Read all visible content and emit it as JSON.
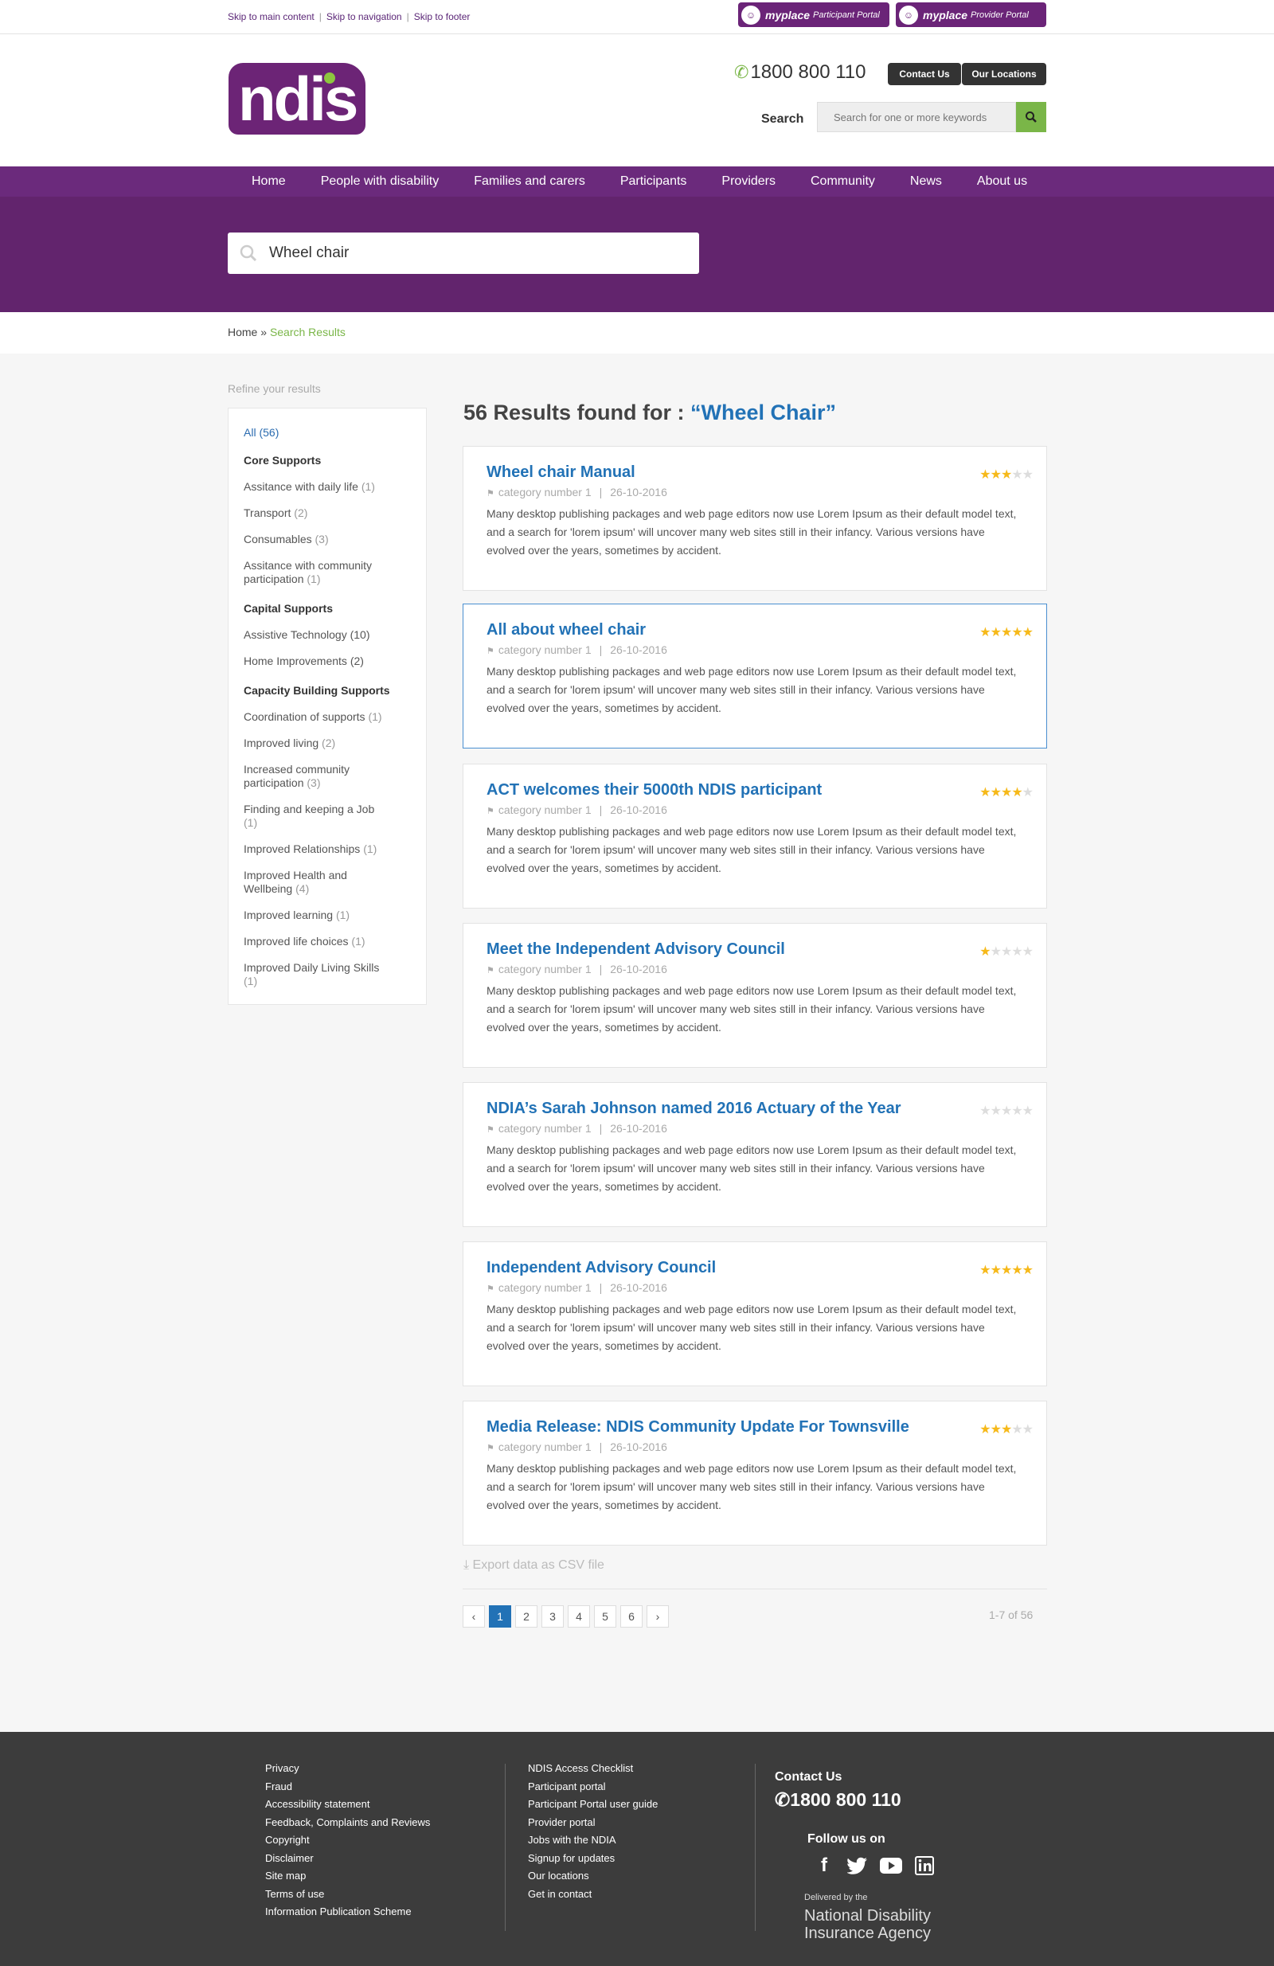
{
  "skip_links": [
    "Skip to main content",
    "Skip to navigation",
    "Skip to footer"
  ],
  "portals": [
    {
      "brand": "myplace",
      "label": "Participant Portal"
    },
    {
      "brand": "myplace",
      "label": "Provider Portal"
    }
  ],
  "header": {
    "logo_text": "ndis",
    "phone": "1800 800 110",
    "contact_button": "Contact Us",
    "locations_button": "Our Locations",
    "search_label": "Search",
    "search_placeholder": "Search for one or more keywords"
  },
  "nav": [
    "Home",
    "People with disability",
    "Families and carers",
    "Participants",
    "Providers",
    "Community",
    "News",
    "About us"
  ],
  "hero_search": {
    "value": "Wheel chair"
  },
  "breadcrumb": {
    "home": "Home",
    "separator": "»",
    "current": "Search Results"
  },
  "sidebar": {
    "title": "Refine your results",
    "all": {
      "label": "All",
      "count": "(56)"
    },
    "groups": [
      {
        "heading": "Core Supports",
        "items": [
          {
            "label": "Assitance with daily life",
            "count": "(1)"
          },
          {
            "label": "Transport",
            "count": "(2)"
          },
          {
            "label": "Consumables",
            "count": "(3)"
          },
          {
            "label": "Assitance with community participation",
            "count": "(1)"
          }
        ]
      },
      {
        "heading": "Capital Supports",
        "items": [
          {
            "label": "Assistive Technology",
            "count": "(10)"
          },
          {
            "label": "Home Improvements",
            "count": "(2)"
          }
        ]
      },
      {
        "heading": "Capacity Building Supports",
        "items": [
          {
            "label": "Coordination of supports",
            "count": "(1)"
          },
          {
            "label": "Improved living",
            "count": "(2)"
          },
          {
            "label": "Increased community participation",
            "count": "(3)"
          },
          {
            "label": "Finding and keeping a Job",
            "count": "(1)"
          },
          {
            "label": "Improved Relationships",
            "count": "(1)"
          },
          {
            "label": "Improved Health and Wellbeing",
            "count": "(4)"
          },
          {
            "label": "Improved learning",
            "count": "(1)"
          },
          {
            "label": "Improved life choices",
            "count": "(1)"
          },
          {
            "label": "Improved Daily Living Skills",
            "count": "(1)"
          }
        ]
      }
    ]
  },
  "results": {
    "heading_prefix": "56 Results found for :",
    "query": "“Wheel Chair”",
    "items": [
      {
        "title": "Wheel chair Manual",
        "category": "category number 1",
        "date": "26-10-2016",
        "rating": 3,
        "text": "Many desktop publishing packages and web page editors now use Lorem Ipsum as their default model text, and a search for 'lorem ipsum' will uncover many web sites still in their infancy. Various versions have evolved over the years, sometimes by accident."
      },
      {
        "title": "All about wheel chair",
        "category": "category number 1",
        "date": "26-10-2016",
        "rating": 5,
        "text": "Many desktop publishing packages and web page editors now use Lorem Ipsum as their default model text, and a search for 'lorem ipsum' will uncover many web sites still in their infancy. Various versions have evolved over the years, sometimes by accident."
      },
      {
        "title": "ACT welcomes their 5000th NDIS participant",
        "category": "category number 1",
        "date": "26-10-2016",
        "rating": 4,
        "text": "Many desktop publishing packages and web page editors now use Lorem Ipsum as their default model text, and a search for 'lorem ipsum' will uncover many web sites still in their infancy. Various versions have evolved over the years, sometimes by accident."
      },
      {
        "title": "Meet the Independent Advisory Council",
        "category": "category number 1",
        "date": "26-10-2016",
        "rating": 1,
        "text": "Many desktop publishing packages and web page editors now use Lorem Ipsum as their default model text, and a search for 'lorem ipsum' will uncover many web sites still in their infancy. Various versions have evolved over the years, sometimes by accident."
      },
      {
        "title": "NDIA’s Sarah Johnson named 2016 Actuary of the Year",
        "category": "category number 1",
        "date": "26-10-2016",
        "rating": 0,
        "text": "Many desktop publishing packages and web page editors now use Lorem Ipsum as their default model text, and a search for 'lorem ipsum' will uncover many web sites still in their infancy. Various versions have evolved over the years, sometimes by accident."
      },
      {
        "title": "Independent Advisory Council",
        "category": "category number 1",
        "date": "26-10-2016",
        "rating": 5,
        "text": "Many desktop publishing packages and web page editors now use Lorem Ipsum as their default model text, and a search for 'lorem ipsum' will uncover many web sites still in their infancy. Various versions have evolved over the years, sometimes by accident."
      },
      {
        "title": "Media Release: NDIS Community Update For Townsville",
        "category": "category number 1",
        "date": "26-10-2016",
        "rating": 3,
        "text": "Many desktop publishing packages and web page editors now use Lorem Ipsum as their default model text, and a search for 'lorem ipsum' will uncover many web sites still in their infancy. Various versions have evolved over the years, sometimes by accident."
      }
    ],
    "export_label": "Export data as CSV file",
    "pages": [
      "1",
      "2",
      "3",
      "4",
      "5",
      "6"
    ],
    "current_page": "1",
    "count_text": "1-7 of 56"
  },
  "footer": {
    "col1": [
      "Privacy",
      "Fraud",
      "Accessibility statement",
      "Feedback, Complaints and Reviews",
      "Copyright",
      "Disclaimer",
      "Site map",
      "Terms of use",
      "Information Publication Scheme"
    ],
    "col2": [
      "NDIS Access Checklist",
      "Participant portal",
      "Participant Portal user guide",
      "Provider portal",
      "Jobs with the NDIA",
      "Signup for updates",
      "Our locations",
      "Get in contact"
    ],
    "contact_heading": "Contact Us",
    "phone": "1800 800 110",
    "follow_heading": "Follow us on",
    "delivered_by": "Delivered by the",
    "agency": "National Disability Insurance Agency"
  },
  "colors": {
    "brand_purple": "#6b2a7c",
    "accent_green": "#7ab648",
    "link_blue": "#2272b6",
    "star_gold": "#f6b91a"
  }
}
